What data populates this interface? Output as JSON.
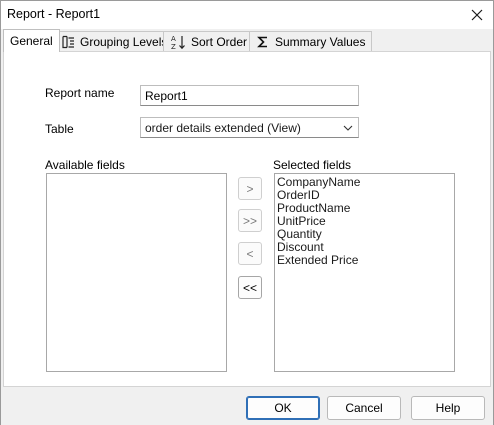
{
  "window": {
    "title": "Report - Report1"
  },
  "tabs": [
    {
      "label": "General",
      "icon": "none",
      "active": true
    },
    {
      "label": "Grouping Levels",
      "icon": "grouping-levels-icon",
      "active": false
    },
    {
      "label": "Sort Order",
      "icon": "sort-az-icon",
      "active": false
    },
    {
      "label": "Summary Values",
      "icon": "sigma-icon",
      "active": false
    }
  ],
  "form": {
    "report_name_label": "Report name",
    "report_name_value": "Report1",
    "table_label": "Table",
    "table_value": "order details extended (View)",
    "available_label": "Available fields",
    "selected_label": "Selected fields"
  },
  "available_fields": [],
  "selected_fields": [
    "CompanyName",
    "OrderID",
    "ProductName",
    "UnitPrice",
    "Quantity",
    "Discount",
    "Extended Price"
  ],
  "move_buttons": {
    "add_one": ">",
    "add_all": ">>",
    "remove_one": "<",
    "remove_all": "<<"
  },
  "buttons": {
    "ok": "OK",
    "cancel": "Cancel",
    "help": "Help"
  },
  "colors": {
    "default_button_border": "#2f6fb6",
    "panel_bg": "#ffffff",
    "chrome_bg": "#f0f0f0"
  }
}
